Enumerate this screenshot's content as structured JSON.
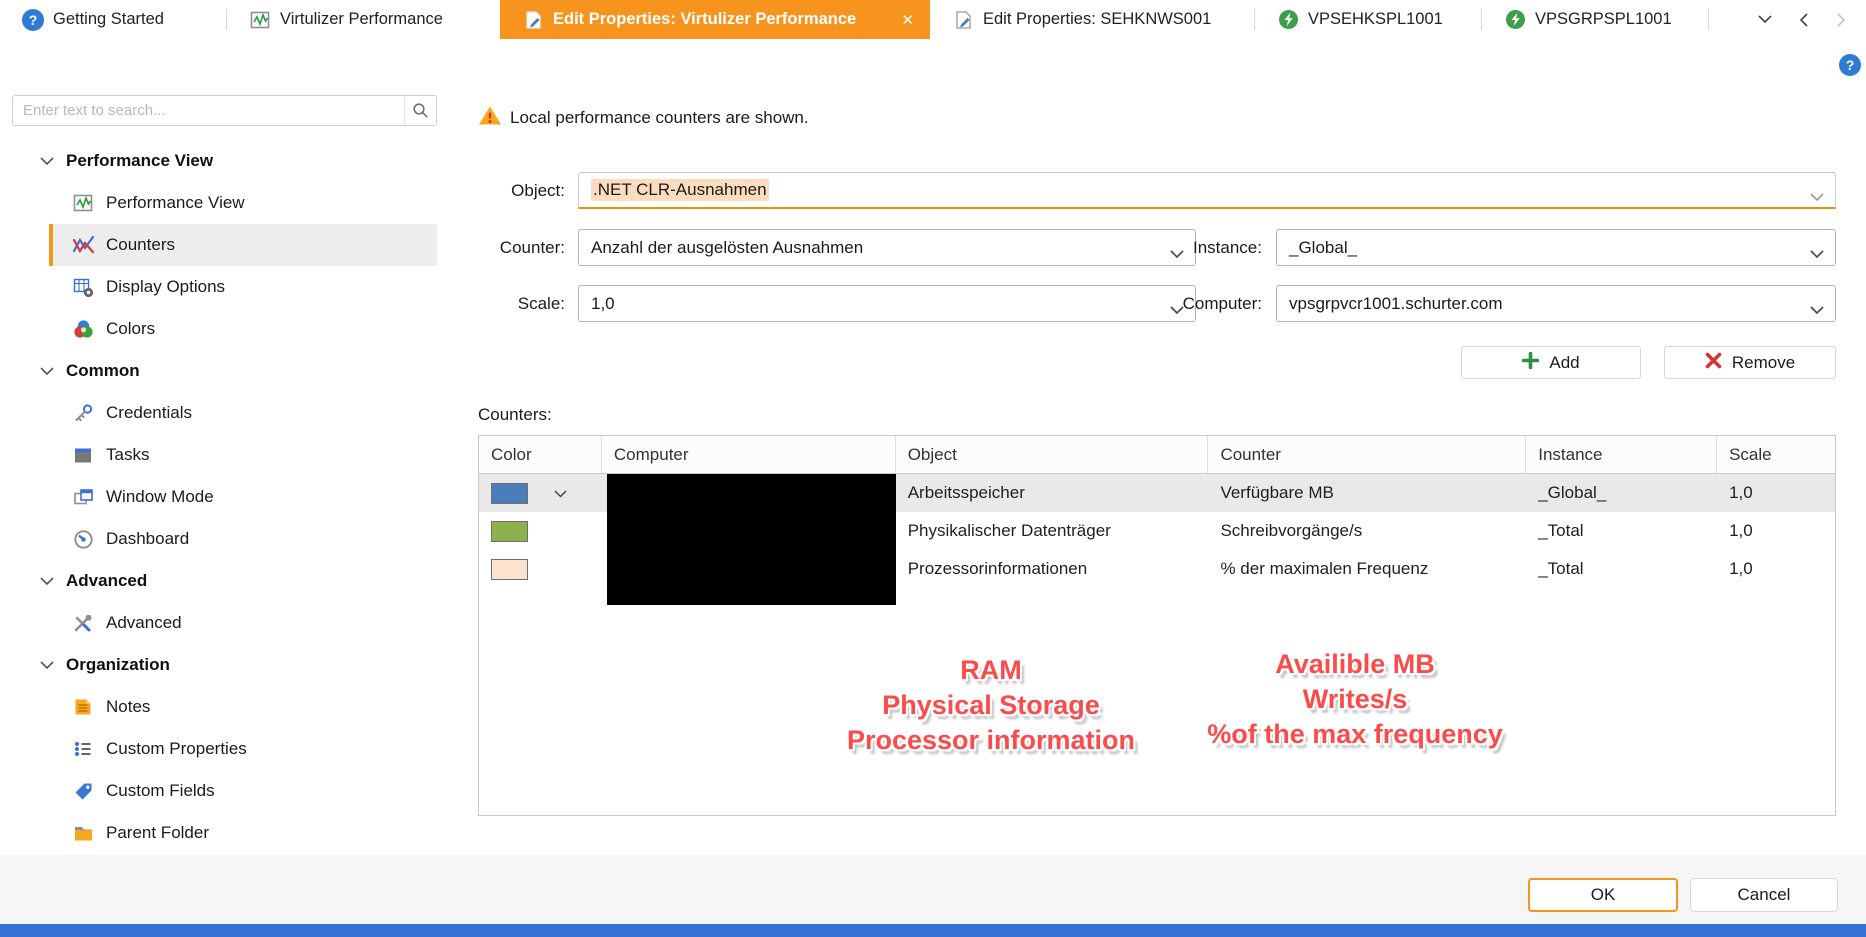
{
  "window": {
    "help_glyph": "?"
  },
  "tabs": [
    {
      "label": "Getting Started",
      "icon": "help-circle-icon",
      "active": false
    },
    {
      "label": "Virtulizer Performance",
      "icon": "performance-chart-icon",
      "active": false
    },
    {
      "label": "Edit Properties: Virtulizer Performance",
      "icon": "edit-page-icon",
      "active": true,
      "close_glyph": "✕"
    },
    {
      "label": "Edit Properties: SEHKNWS001",
      "icon": "edit-page-icon",
      "active": false
    },
    {
      "label": "VPSEHKSPL1001",
      "icon": "server-icon",
      "active": false
    },
    {
      "label": "VPSGRPSPL1001",
      "icon": "server-icon",
      "active": false
    }
  ],
  "sidebar": {
    "search_placeholder": "Enter text to search...",
    "items": [
      {
        "type": "group",
        "label": "Performance View"
      },
      {
        "type": "item",
        "label": "Performance View",
        "icon": "performance-chart-icon"
      },
      {
        "type": "item",
        "label": "Counters",
        "icon": "counters-icon",
        "selected": true
      },
      {
        "type": "item",
        "label": "Display Options",
        "icon": "display-options-icon"
      },
      {
        "type": "item",
        "label": "Colors",
        "icon": "colors-icon"
      },
      {
        "type": "group",
        "label": "Common"
      },
      {
        "type": "item",
        "label": "Credentials",
        "icon": "key-icon"
      },
      {
        "type": "item",
        "label": "Tasks",
        "icon": "tasks-icon"
      },
      {
        "type": "item",
        "label": "Window Mode",
        "icon": "window-mode-icon"
      },
      {
        "type": "item",
        "label": "Dashboard",
        "icon": "dashboard-icon"
      },
      {
        "type": "group",
        "label": "Advanced"
      },
      {
        "type": "item",
        "label": "Advanced",
        "icon": "tools-icon"
      },
      {
        "type": "group",
        "label": "Organization"
      },
      {
        "type": "item",
        "label": "Notes",
        "icon": "notes-icon"
      },
      {
        "type": "item",
        "label": "Custom Properties",
        "icon": "bullet-list-icon"
      },
      {
        "type": "item",
        "label": "Custom Fields",
        "icon": "tag-icon"
      },
      {
        "type": "item",
        "label": "Parent Folder",
        "icon": "folder-icon"
      }
    ]
  },
  "warning": {
    "text": "Local performance counters are shown."
  },
  "form": {
    "object_label": "Object:",
    "object_value": ".NET CLR-Ausnahmen",
    "counter_label": "Counter:",
    "counter_value": "Anzahl der ausgelösten Ausnahmen",
    "instance_label": "Instance:",
    "instance_value": "_Global_",
    "scale_label": "Scale:",
    "scale_value": "1,0",
    "computer_label": "Computer:",
    "computer_value": "vpsgrpvcr1001.schurter.com"
  },
  "actions": {
    "add": "Add",
    "remove": "Remove",
    "ok": "OK",
    "cancel": "Cancel"
  },
  "counters_section": {
    "label": "Counters:"
  },
  "table": {
    "columns": [
      "Color",
      "Computer",
      "Object",
      "Counter",
      "Instance",
      "Scale"
    ],
    "computer_column_redacted": true,
    "rows": [
      {
        "color": "#4a7ebb",
        "object": "Arbeitsspeicher",
        "counter": "Verfügbare MB",
        "instance": "_Global_",
        "scale": "1,0",
        "selected": true
      },
      {
        "color": "#8db14c",
        "object": "Physikalischer Datenträger",
        "counter": "Schreibvorgänge/s",
        "instance": "_Total",
        "scale": "1,0",
        "selected": false
      },
      {
        "color": "#fbe3cf",
        "object": "Prozessorinformationen",
        "counter": "% der maximalen Frequenz",
        "instance": "_Total",
        "scale": "1,0",
        "selected": false
      }
    ]
  },
  "annotations": {
    "color": "#fb4b4b",
    "left": [
      "RAM",
      "Physical Storage",
      "Processor information"
    ],
    "right": [
      "Availible MB",
      "Writes/s",
      "%of the max frequency"
    ]
  },
  "theme": {
    "accent_orange": "#f7941e",
    "status_bar_blue": "#3371d6",
    "selection_peach": "#fbdcbc"
  }
}
